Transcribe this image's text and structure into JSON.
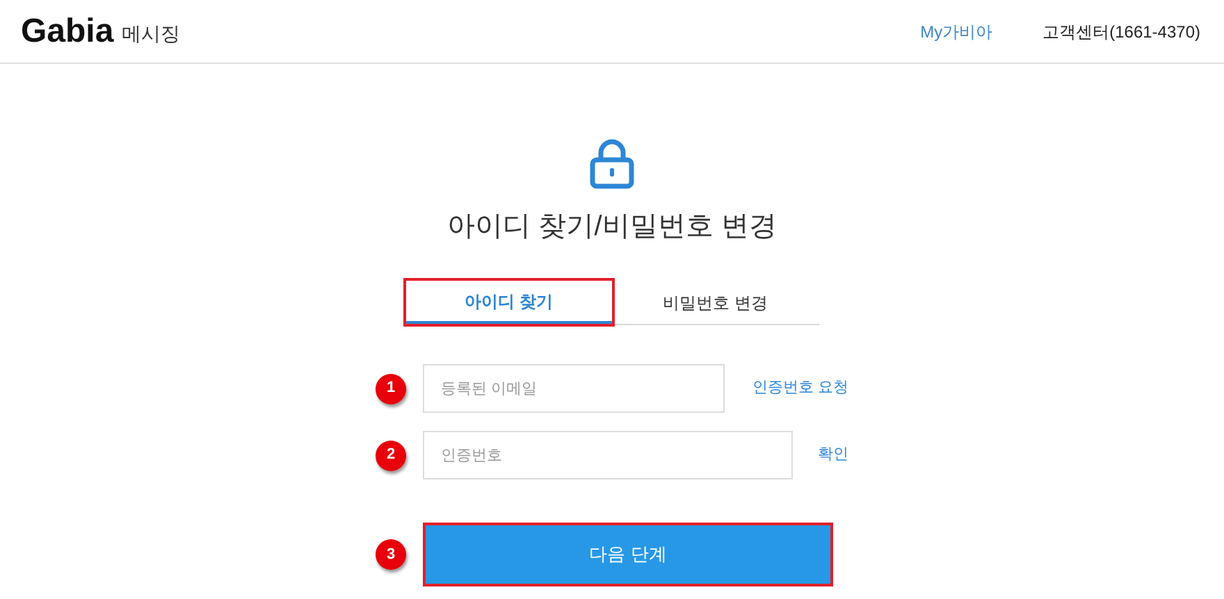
{
  "header": {
    "logo": "Gabia",
    "service": "메시징",
    "links": [
      {
        "label": "My가비아",
        "kind": "link"
      },
      {
        "label": "고객센터(1661-4370)",
        "kind": "text"
      }
    ]
  },
  "title": "아이디 찾기/비밀번호 변경",
  "tabs": [
    {
      "label": "아이디 찾기",
      "selected": true,
      "highlighted": true
    },
    {
      "label": "비밀번호 변경",
      "selected": false,
      "highlighted": false
    }
  ],
  "fields": [
    {
      "step": "1",
      "placeholder": "등록된 이메일",
      "action": "인증번호 요청"
    },
    {
      "step": "2",
      "placeholder": "인증번호",
      "action": "확인"
    }
  ],
  "next": {
    "step": "3",
    "label": "다음 단계",
    "highlighted": true
  }
}
